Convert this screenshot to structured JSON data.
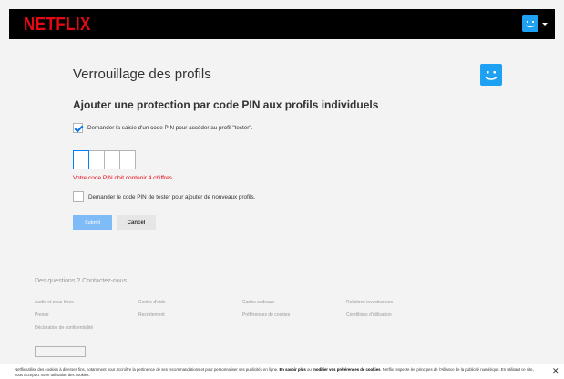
{
  "header": {
    "logo_text": "NETFLIX",
    "brand_color": "#e50914",
    "avatar_color": "#1ea1f2"
  },
  "main": {
    "title": "Verrouillage des profils",
    "subtitle": "Ajouter une protection par code PIN aux profils individuels",
    "require_pin_label": "Demander la saisie d'un code PIN pour accéder au profil \"tester\".",
    "require_pin_checked": true,
    "pin_digits": [
      "",
      "",
      "",
      ""
    ],
    "error_text": "Votre code PIN doit contenir 4 chiffres.",
    "error_color": "#e50914",
    "new_profiles_label": "Demander le code PIN de tester pour ajouter de nouveaux profils.",
    "new_profiles_checked": false,
    "submit_label": "Submit",
    "cancel_label": "Cancel"
  },
  "footer": {
    "questions": "Des questions ? Contactez-nous.",
    "links": [
      "Audio et sous-titres",
      "Centre d'aide",
      "Cartes cadeaux",
      "Relations investisseurs",
      "Presse",
      "Recrutement",
      "Préférences de cookies",
      "Conditions d'utilisation",
      "Déclaration de confidentialité"
    ]
  },
  "cookie_banner": {
    "text_start": "Netflix utilise des cookies à diverses fins, notamment pour accroître la pertinence de ses recommandations et pour personnaliser ses publicités en ligne.",
    "learn_more": "En savoir plus",
    "or": "ou",
    "modify_prefs": "modifier vos préférences de cookies",
    "text_end": ". Netflix respecte les principes de l'Alliance de la publicité numérique. En utilisant ce site, vous acceptez notre utilisation des cookies.",
    "close_icon": "close-icon"
  }
}
